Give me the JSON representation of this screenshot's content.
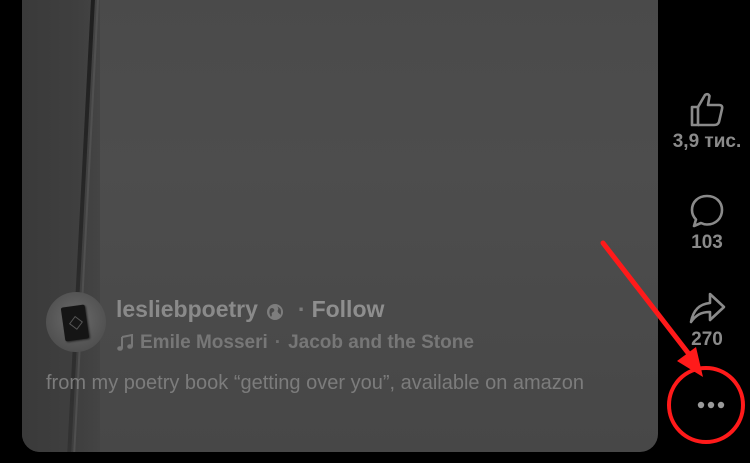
{
  "colors": {
    "background": "#000000",
    "video_surface": "#4a4a4a",
    "text_muted": "#8a8a8a",
    "annotation_red": "#ff1a1a"
  },
  "post": {
    "author": {
      "username": "lesliebpoetry",
      "avatar_icon": "avatar-book-image",
      "globe_icon": "globe-icon",
      "separator": "·",
      "follow_label": "Follow"
    },
    "music": {
      "icon": "music-note-icon",
      "artist": "Emile Mosseri",
      "separator": "·",
      "track": "Jacob and the Stone"
    },
    "caption": "from my poetry book “getting over you”, available on amazon"
  },
  "actions": {
    "like": {
      "icon": "thumbs-up-icon",
      "count": "3,9 тис."
    },
    "comment": {
      "icon": "comment-bubble-icon",
      "count": "103"
    },
    "share": {
      "icon": "share-arrow-icon",
      "count": "270"
    },
    "more": {
      "icon": "more-dots-icon"
    }
  },
  "annotation": {
    "type": "red arrow pointing to circled more-options button"
  }
}
